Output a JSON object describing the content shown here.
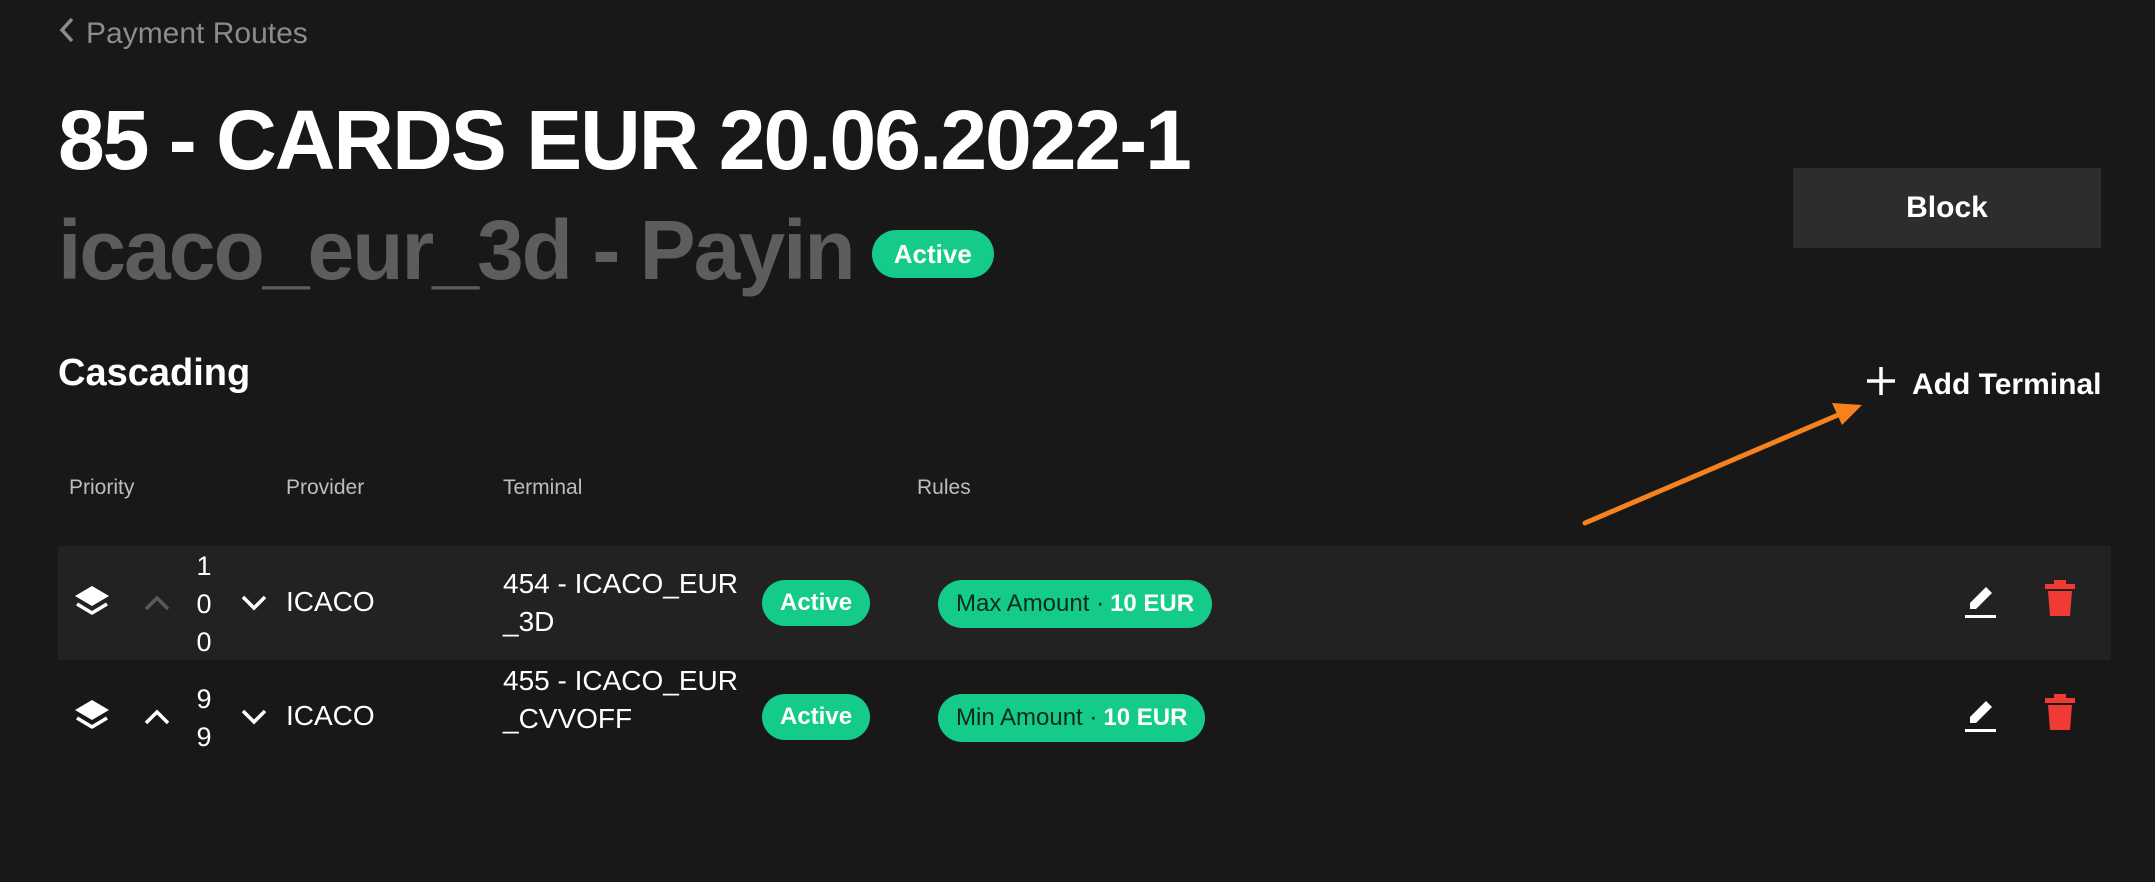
{
  "breadcrumb": {
    "label": "Payment Routes"
  },
  "header": {
    "title": "85 - CARDS EUR 20.06.2022-1",
    "subtitle": "icaco_eur_3d - Payin",
    "status": "Active",
    "block_label": "Block"
  },
  "cascading": {
    "title": "Cascading",
    "add_label": "Add Terminal",
    "columns": {
      "priority": "Priority",
      "provider": "Provider",
      "terminal": "Terminal",
      "rules": "Rules"
    },
    "rows": [
      {
        "priority": [
          "1",
          "0",
          "0"
        ],
        "provider": "ICACO",
        "terminal": "454 - ICACO_EUR_3D",
        "status": "Active",
        "rule_label": "Max Amount ·",
        "rule_value": "10 EUR"
      },
      {
        "priority": [
          "9",
          "9"
        ],
        "provider": "ICACO",
        "terminal": "455 - ICACO_EUR_CVVOFF",
        "status": "Active",
        "rule_label": "Min Amount ·",
        "rule_value": "10 EUR"
      }
    ]
  },
  "colors": {
    "accent": "#15cb8a",
    "danger": "#ef3b34",
    "annotation": "#f5821f",
    "background": "#181818"
  },
  "icons": [
    "chevron-left-icon",
    "layers-icon",
    "chevron-up-icon",
    "chevron-down-icon",
    "plus-icon",
    "edit-icon",
    "trash-icon"
  ]
}
